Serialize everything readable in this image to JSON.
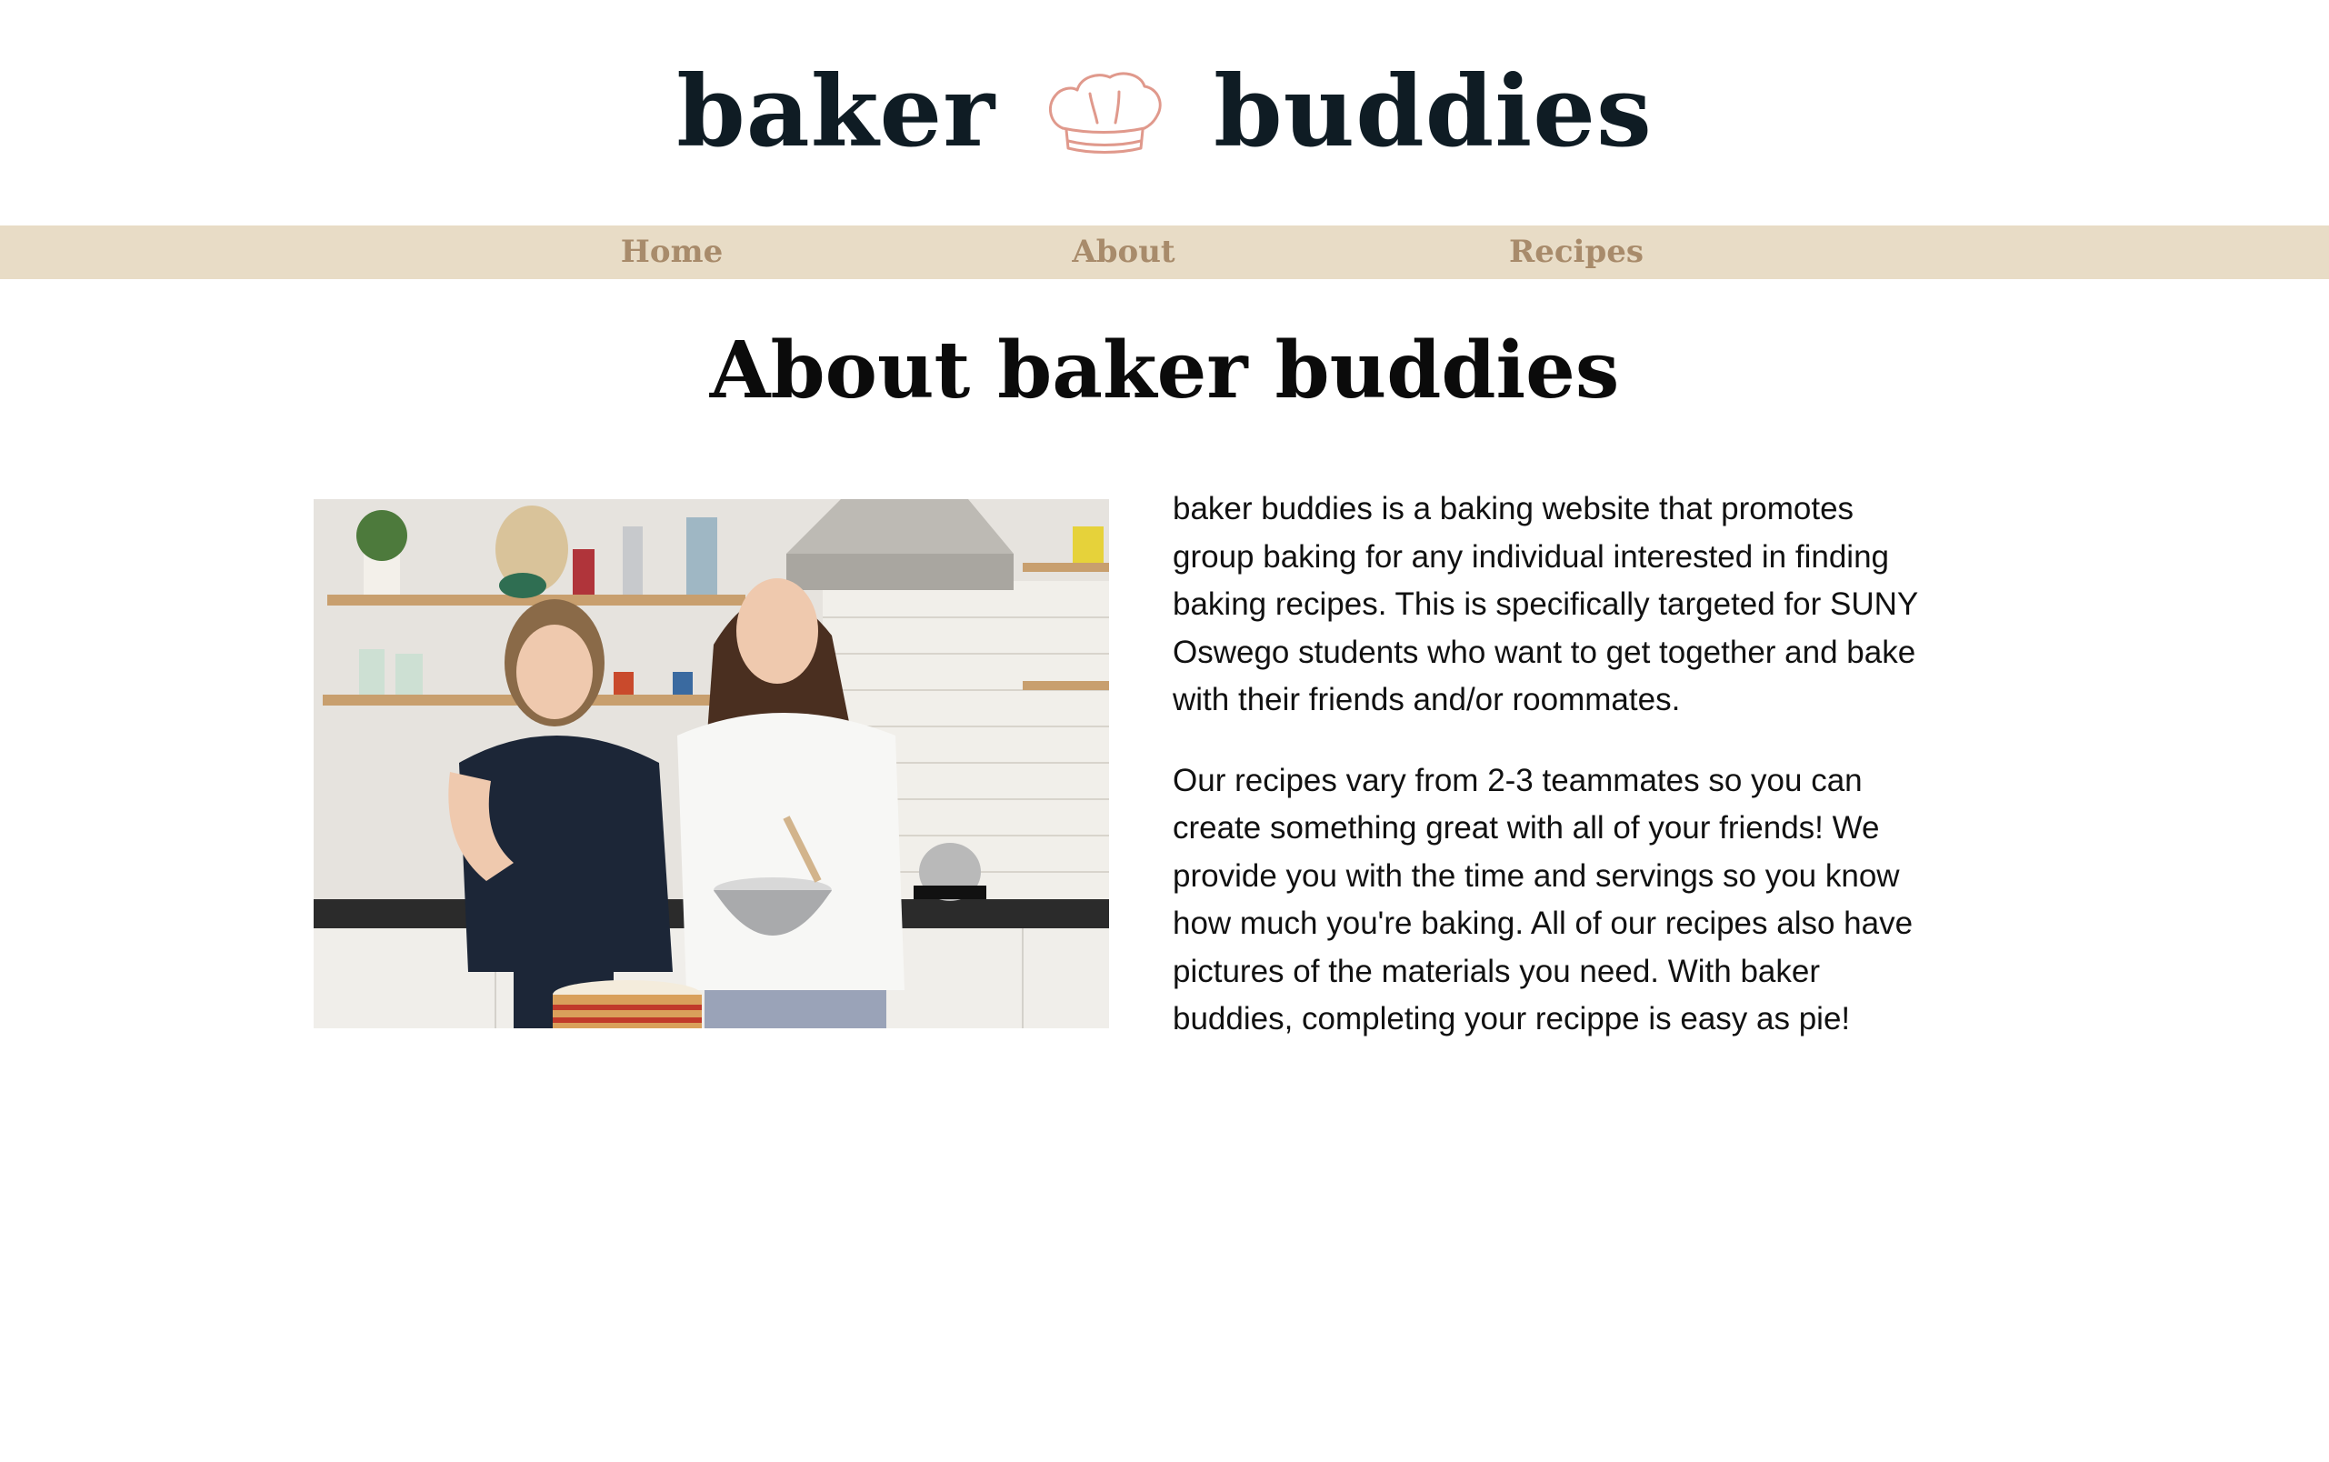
{
  "logo": {
    "word_left": "baker",
    "word_right": "buddies",
    "icon": "chef-hat-icon"
  },
  "nav": {
    "items": [
      {
        "label": "Home"
      },
      {
        "label": "About"
      },
      {
        "label": "Recipes"
      }
    ]
  },
  "main": {
    "title": "About baker buddies",
    "image": {
      "alt": "Two women laughing while baking a layered cake in a kitchen"
    },
    "paragraphs": [
      "baker buddies is a baking website that promotes group baking for any individual interested in finding baking recipes. This is specifically targeted for SUNY Oswego students who want to get together and bake with their friends and/or roommates.",
      "Our recipes vary from 2-3 teammates so you can create something great with all of your friends! We provide you with the time and servings so you know how much you're baking. All of our recipes also have pictures of the materials you need. With baker buddies, completing your recippe is easy as pie!"
    ]
  },
  "colors": {
    "nav_background": "#e8dcc6",
    "nav_text": "#a88b6b",
    "logo_text": "#0f1c24",
    "hat_stroke": "#e0998c"
  }
}
